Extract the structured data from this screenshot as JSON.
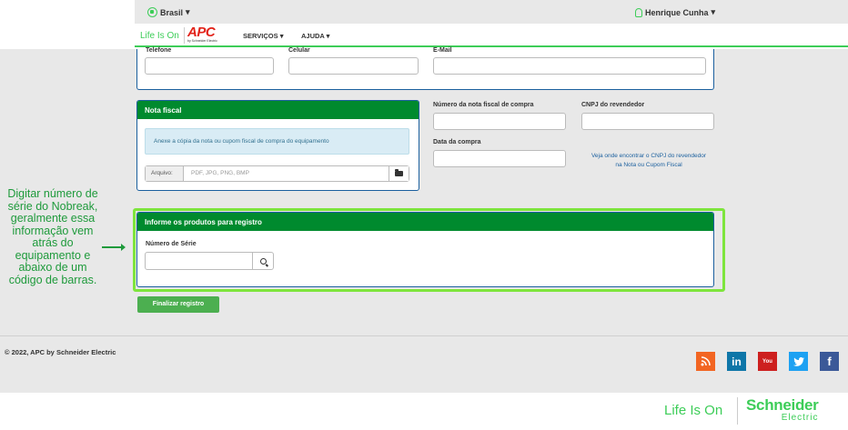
{
  "header": {
    "country": "Brasil",
    "user_name": "Henrique Cunha",
    "caret": "▾"
  },
  "nav": {
    "brand_tagline": "Life Is On",
    "logo_text": "APC",
    "logo_sub": "by Schneider Electric",
    "items": [
      "SERVIÇOS",
      "AJUDA"
    ]
  },
  "contact": {
    "phone_label": "Telefone",
    "mobile_label": "Celular",
    "email_label": "E-Mail"
  },
  "nota": {
    "title": "Nota fiscal",
    "info": "Anexe a cópia da nota ou cupom fiscal de compra do equipamento",
    "file_label": "Arquivo:",
    "file_placeholder": "PDF, JPG, PNG, BMP",
    "invoice_number_label": "Número da nota fiscal de compra",
    "cnpj_label": "CNPJ do revendedor",
    "purchase_date_label": "Data da compra",
    "cnpj_help": "Veja onde encontrar o CNPJ do revendedor na Nota ou Cupom Fiscal"
  },
  "products": {
    "title": "Informe os produtos para registro",
    "serial_label": "Número de Série"
  },
  "actions": {
    "submit": "Finalizar registro"
  },
  "annotation": {
    "text": "Digitar número de série do Nobreak, geralmente essa informação vem atrás do equipamento e abaixo de um código de barras.",
    "color": "#1e9a3b"
  },
  "footer": {
    "copyright": "© 2022, APC by Schneider Electric",
    "social": [
      {
        "name": "rss",
        "glyph": "))",
        "color": "#f26522"
      },
      {
        "name": "linkedin",
        "glyph": "in",
        "color": "#0e76a8"
      },
      {
        "name": "youtube",
        "glyph": "You",
        "color": "#cd201f"
      },
      {
        "name": "twitter",
        "glyph": "✉",
        "color": "#1da1f2"
      },
      {
        "name": "facebook",
        "glyph": "f",
        "color": "#3b5998"
      }
    ]
  },
  "bottom": {
    "tagline": "Life Is On",
    "brand_line1": "Schneider",
    "brand_line2": "Electric"
  },
  "colors": {
    "green": "#3dcd58",
    "panel_header": "#008a2e",
    "panel_border": "#1a5f9e",
    "highlight": "#7ee53d"
  }
}
